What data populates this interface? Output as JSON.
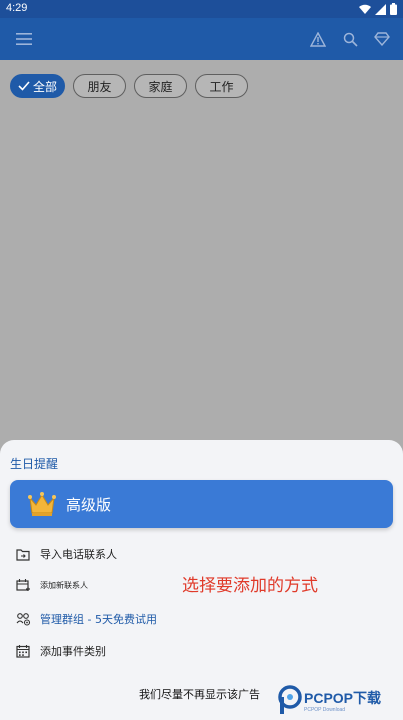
{
  "status_bar": {
    "time": "4:29",
    "icons": [
      "wifi-icon",
      "signal-icon",
      "battery-icon"
    ]
  },
  "app_bar": {
    "icons": [
      "menu-icon",
      "warning-icon",
      "search-icon",
      "diamond-icon"
    ]
  },
  "filters": [
    {
      "label": "全部",
      "selected": true
    },
    {
      "label": "朋友",
      "selected": false
    },
    {
      "label": "家庭",
      "selected": false
    },
    {
      "label": "工作",
      "selected": false
    }
  ],
  "sheet": {
    "title": "生日提醒",
    "premium": {
      "label": "高级版",
      "icon": "crown-icon"
    },
    "items": [
      {
        "label": "导入电话联系人",
        "icon": "folder-import-icon"
      },
      {
        "label": "添加新联系人",
        "icon": "calendar-add-icon"
      },
      {
        "label": "管理群组 - 5天免费试用",
        "icon": "group-settings-icon"
      },
      {
        "label": "添加事件类别",
        "icon": "calendar-grid-icon"
      }
    ],
    "ad_notice": "我们尽量不再显示该广告"
  },
  "overlay_caption": "选择要添加的方式",
  "watermark": {
    "text": "PCPOP下载",
    "sub": "PCPOP Download"
  },
  "colors": {
    "primary": "#1f5aa8",
    "premium": "#3a7ad6",
    "caption": "#e03a2a"
  }
}
